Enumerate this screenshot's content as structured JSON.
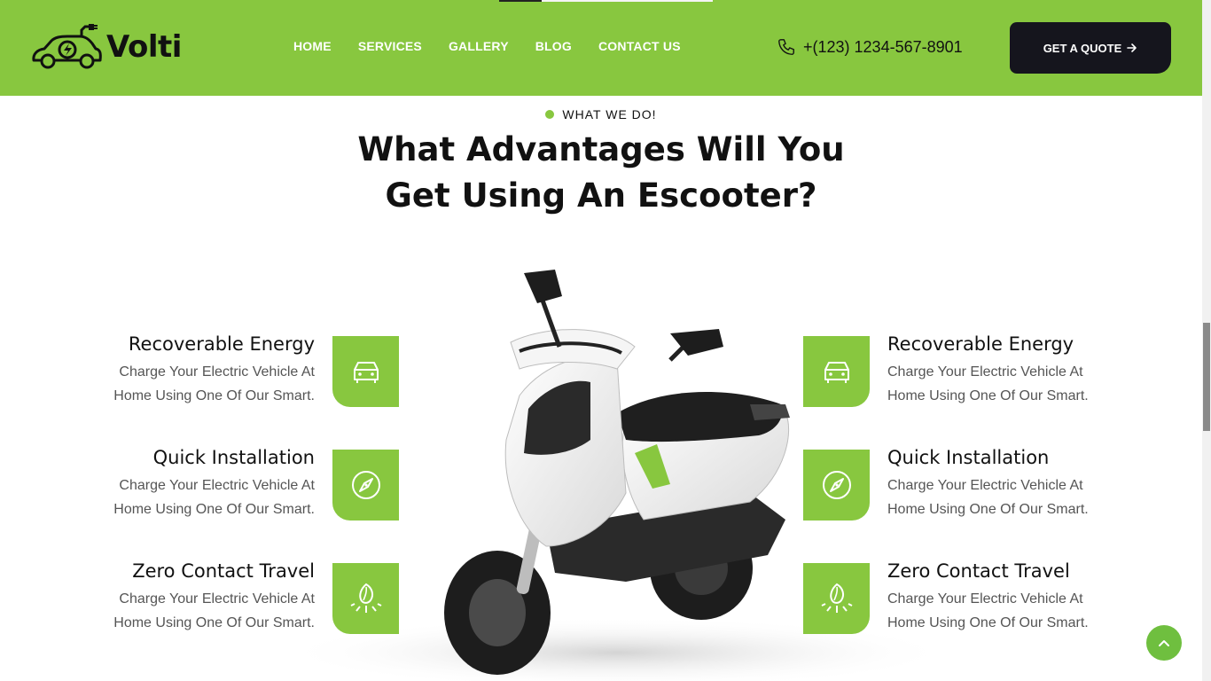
{
  "brand": {
    "name": "Volti",
    "accent": "#88c73f",
    "dark": "#15151d"
  },
  "nav": {
    "items": [
      {
        "label": "HOME"
      },
      {
        "label": "SERVICES"
      },
      {
        "label": "GALLERY"
      },
      {
        "label": "BLOG"
      },
      {
        "label": "CONTACT US"
      }
    ]
  },
  "header": {
    "phone": "+(123) 1234-567-8901",
    "phone_icon": "phone-icon",
    "quote_label": "GET A QUOTE",
    "quote_icon": "arrow-right-icon"
  },
  "section": {
    "eyebrow": "WHAT WE DO!",
    "title_line1": "What Advantages Will You",
    "title_line2": "Get Using An Escooter?"
  },
  "features_left": [
    {
      "title": "Recoverable Energy",
      "desc1": "Charge Your Electric Vehicle At",
      "desc2": "Home Using One Of Our Smart.",
      "icon": "car-icon"
    },
    {
      "title": "Quick Installation",
      "desc1": "Charge Your Electric Vehicle At",
      "desc2": "Home Using One Of Our Smart.",
      "icon": "compass-icon"
    },
    {
      "title": "Zero Contact Travel",
      "desc1": "Charge Your Electric Vehicle At",
      "desc2": "Home Using One Of Our Smart.",
      "icon": "eco-leaf-icon"
    }
  ],
  "features_right": [
    {
      "title": "Recoverable Energy",
      "desc1": "Charge Your Electric Vehicle At",
      "desc2": "Home Using One Of Our Smart.",
      "icon": "car-icon"
    },
    {
      "title": "Quick Installation",
      "desc1": "Charge Your Electric Vehicle At",
      "desc2": "Home Using One Of Our Smart.",
      "icon": "compass-icon"
    },
    {
      "title": "Zero Contact Travel",
      "desc1": "Charge Your Electric Vehicle At",
      "desc2": "Home Using One Of Our Smart.",
      "icon": "eco-leaf-icon"
    }
  ],
  "back_to_top_icon": "chevron-up-icon"
}
